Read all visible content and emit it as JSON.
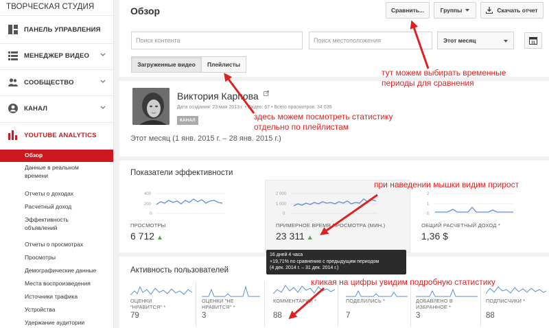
{
  "sidebar": {
    "studio_title": "ТВОРЧЕСКАЯ СТУДИЯ",
    "items": [
      {
        "label": "ПАНЕЛЬ УПРАВЛЕНИЯ",
        "icon": "dashboard-icon"
      },
      {
        "label": "МЕНЕДЖЕР ВИДЕО",
        "icon": "video-manager-icon"
      },
      {
        "label": "СООБЩЕСТВО",
        "icon": "community-icon"
      },
      {
        "label": "КАНАЛ",
        "icon": "channel-icon"
      },
      {
        "label": "YOUTUBE ANALYTICS",
        "icon": "analytics-icon"
      }
    ],
    "analytics_items": {
      "overview": "Обзор",
      "realtime": "Данные в реальном времени",
      "revenue_head": "Отчеты о доходах",
      "est_revenue": "Расчетный доход",
      "ad_performance": "Эффективность объявлений",
      "views_head": "Отчеты о просмотрах",
      "views": "Просмотры",
      "demographics": "Демографические данные",
      "playback_locations": "Места воспроизведения",
      "traffic_sources": "Источники трафика",
      "devices": "Устройства",
      "audience_retention": "Удержание аудитории"
    }
  },
  "header": {
    "title": "Обзор",
    "compare_label": "Сравнить...",
    "groups_label": "Группы",
    "download_label": "Скачать отчет",
    "search_content_placeholder": "Поиск контента",
    "search_location_placeholder": "Поиск местоположения",
    "period_select": "Этот месяц",
    "calendar_day": "31",
    "tabs": [
      "Загруженные видео",
      "Плейлисты"
    ]
  },
  "channel": {
    "name": "Виктория Карпова",
    "meta": "Дата создания: 23 мая 2013 г.  •  Видео: 67  •  Всего просмотров: 34 036",
    "badge": "КАНАЛ",
    "period": "Этот месяц (1 янв. 2015 г. – 28 янв. 2015 г.)"
  },
  "performance": {
    "title": "Показатели эффективности",
    "metrics": [
      {
        "label": "ПРОСМОТРЫ",
        "value": "6 712",
        "trend": "▲"
      },
      {
        "label": "ПРИМЕРНОЕ ВРЕМЯ ПРОСМОТРА (МИН.)",
        "value": "23 311",
        "trend": "▲"
      },
      {
        "label": "ОБЩИЙ РАСЧЕТНЫЙ ДОХОД *",
        "value": "1,36 $",
        "trend": ""
      }
    ],
    "spark_axes": [
      {
        "top": "400",
        "mid": "200",
        "bot": "0"
      },
      {
        "top": "2 000",
        "mid": "1 000",
        "bot": "0"
      },
      {
        "top": "2",
        "mid": "1",
        "bot": "0"
      }
    ],
    "tooltip": {
      "line1": "16 дней 4 часа",
      "line2": "+19,71% по сравнению с предыдущим периодом",
      "line3": "(4 дек. 2014 г. – 31 дек. 2014 г.)"
    }
  },
  "activity": {
    "title": "Активность пользователей",
    "metrics": [
      {
        "label1": "ОЦЕНКИ",
        "label2": "\"НРАВИТСЯ\" *",
        "value": "79"
      },
      {
        "label1": "ОЦЕНКИ \"НЕ",
        "label2": "НРАВИТСЯ\" *",
        "value": "3"
      },
      {
        "label1": "КОММЕНТАРИИ *",
        "label2": "",
        "value": "88"
      },
      {
        "label1": "ПОДЕЛИЛИСЬ *",
        "label2": "",
        "value": "7"
      },
      {
        "label1": "ДОБАВЛЕНО В",
        "label2": "ИЗБРАННОЕ *",
        "value": "3"
      },
      {
        "label1": "ПОДПИСЧИКИ *",
        "label2": "",
        "value": "88"
      }
    ]
  },
  "annotations": {
    "a1_l1": "тут можем выбирать временные",
    "a1_l2": "периоды для сравнения",
    "a2_l1": "здесь можем посмотреть статистику",
    "a2_l2": "отдельно по плейлистам",
    "a3": "при наведении мышки видим прирост",
    "a4": "кликая на цифры увидим подробную статистику"
  },
  "colors": {
    "accent": "#cc181e",
    "annotation": "#e02020",
    "spark": "#5b8fd6",
    "up": "#4caa41"
  }
}
